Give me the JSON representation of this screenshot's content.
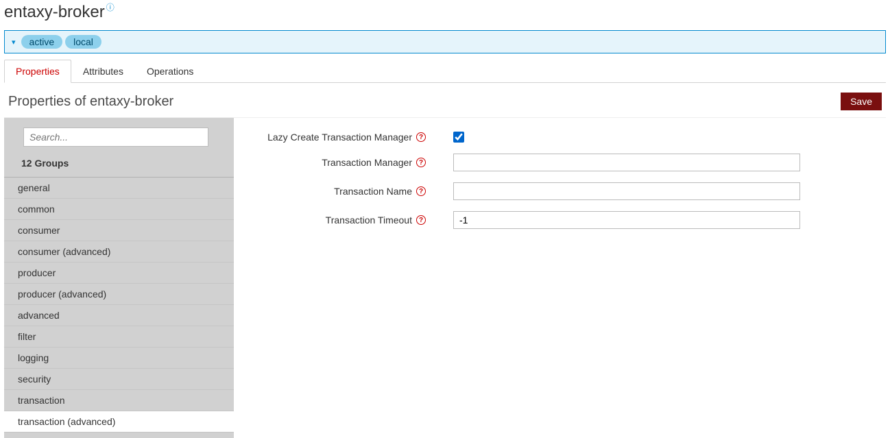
{
  "header": {
    "title": "entaxy-broker"
  },
  "tags": [
    "active",
    "local"
  ],
  "tabs": [
    {
      "label": "Properties",
      "active": true
    },
    {
      "label": "Attributes",
      "active": false
    },
    {
      "label": "Operations",
      "active": false
    }
  ],
  "content": {
    "title": "Properties of entaxy-broker",
    "save_label": "Save"
  },
  "sidebar": {
    "search_placeholder": "Search...",
    "groups_count_label": "12 Groups",
    "groups": [
      {
        "label": "general",
        "selected": false
      },
      {
        "label": "common",
        "selected": false
      },
      {
        "label": "consumer",
        "selected": false
      },
      {
        "label": "consumer (advanced)",
        "selected": false
      },
      {
        "label": "producer",
        "selected": false
      },
      {
        "label": "producer (advanced)",
        "selected": false
      },
      {
        "label": "advanced",
        "selected": false
      },
      {
        "label": "filter",
        "selected": false
      },
      {
        "label": "logging",
        "selected": false
      },
      {
        "label": "security",
        "selected": false
      },
      {
        "label": "transaction",
        "selected": false
      },
      {
        "label": "transaction (advanced)",
        "selected": true
      }
    ]
  },
  "form": {
    "fields": [
      {
        "label": "Lazy Create Transaction Manager",
        "type": "checkbox",
        "value": true,
        "name": "lazy-create-transaction-manager"
      },
      {
        "label": "Transaction Manager",
        "type": "text",
        "value": "",
        "name": "transaction-manager"
      },
      {
        "label": "Transaction Name",
        "type": "text",
        "value": "",
        "name": "transaction-name"
      },
      {
        "label": "Transaction Timeout",
        "type": "number",
        "value": "-1",
        "name": "transaction-timeout"
      }
    ]
  }
}
